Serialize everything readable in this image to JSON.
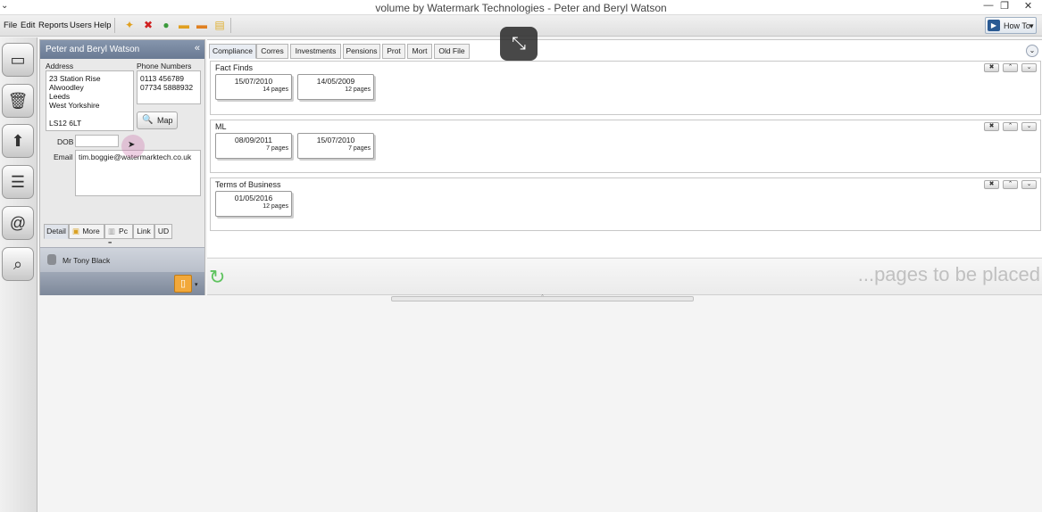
{
  "window": {
    "title": "volume by Watermark Technologies - Peter and Beryl Watson",
    "min": "—",
    "max": "❐",
    "close": "✕",
    "chevron": "⌄"
  },
  "menu": {
    "file": "File",
    "edit": "Edit",
    "reports": "Reports",
    "users": "Users",
    "help": "Help"
  },
  "howto": {
    "label": "How To",
    "caret": "▾"
  },
  "client": {
    "name": "Peter and Beryl Watson",
    "collapse": "«",
    "address_label": "Address",
    "address": [
      "23 Station Rise",
      "Alwoodley",
      "Leeds",
      "West Yorkshire",
      "",
      "LS12 6LT"
    ],
    "phone_label": "Phone Numbers",
    "phones": [
      "0113 456789",
      "07734 5888932"
    ],
    "map_label": "Map",
    "dob_label": "DOB",
    "dob_value": "",
    "email_label": "Email",
    "email_value": "tim.boggie@watermarktech.co.uk",
    "tabs": [
      "Detail",
      "More",
      "Pc",
      "Link",
      "UD"
    ],
    "grip": "''''''''''",
    "associate": "Mr Tony Black",
    "dropdown": "▾"
  },
  "tabs": [
    "Compliance",
    "Corres",
    "Investments",
    "Pensions",
    "Prot",
    "Mort",
    "Old File"
  ],
  "groups": [
    {
      "title": "Fact Finds",
      "docs": [
        {
          "date": "15/07/2010",
          "pages": "14 pages"
        },
        {
          "date": "14/05/2009",
          "pages": "12 pages"
        }
      ]
    },
    {
      "title": "ML",
      "docs": [
        {
          "date": "08/09/2011",
          "pages": "7 pages"
        },
        {
          "date": "15/07/2010",
          "pages": "7 pages"
        }
      ]
    },
    {
      "title": "Terms of Business",
      "docs": [
        {
          "date": "01/05/2016",
          "pages": "12 pages"
        }
      ]
    }
  ],
  "group_controls": {
    "close": "✖",
    "up": "⌃",
    "down": "⌄"
  },
  "pages_message": "...pages to be placed",
  "splitter_glyph": "ˆ",
  "icons": {
    "leftstrip": [
      "client-icon",
      "bin-icon",
      "upload-arrow-icon",
      "list-icon",
      "email-icon",
      "search-icon"
    ],
    "toolbar": [
      "new-client-icon",
      "delete-icon",
      "people-icon",
      "folder-icon",
      "folder-remove-icon",
      "notes-icon"
    ]
  },
  "colors": {
    "panel_header": "#6a7a93",
    "accent_orange": "#f2a83a",
    "refresh_green": "#5fc35f"
  }
}
